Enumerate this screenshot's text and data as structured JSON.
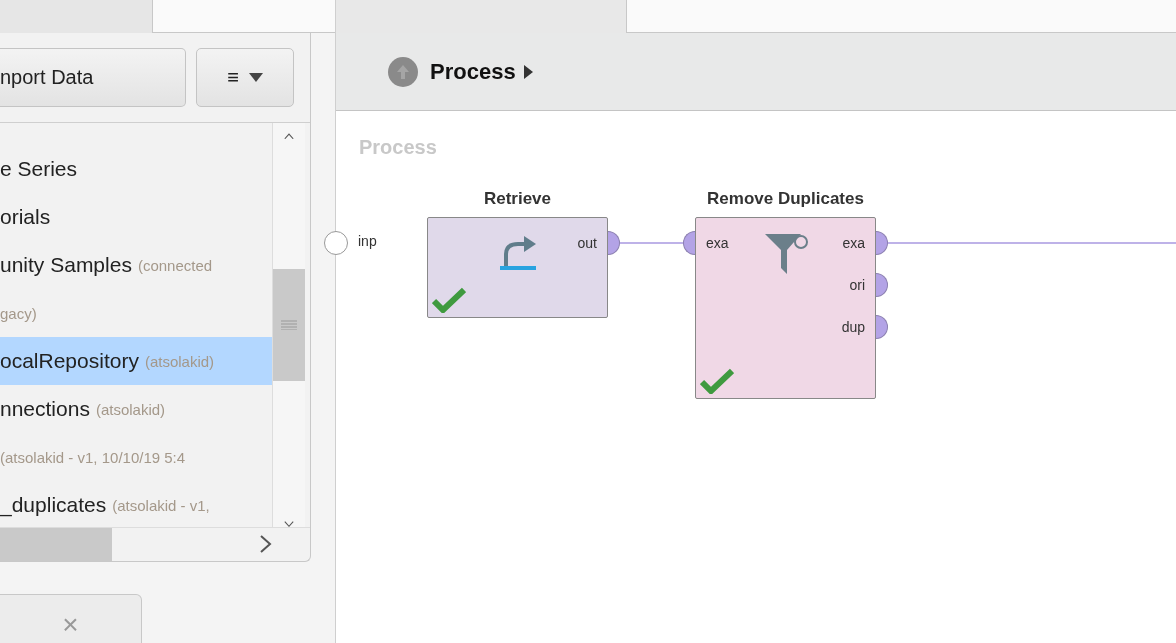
{
  "repository_panel": {
    "import_button": "nport Data",
    "menu_button": "≡",
    "rows": [
      {
        "name": "e Series",
        "detail": "",
        "selected": false
      },
      {
        "name": "orials",
        "detail": "",
        "selected": false
      },
      {
        "name": "unity Samples",
        "detail": "(connected",
        "selected": false
      },
      {
        "name": "",
        "detail": "gacy)",
        "selected": false
      },
      {
        "name": "ocalRepository",
        "detail": "(atsolakid)",
        "selected": true
      },
      {
        "name": "nnections",
        "detail": "(atsolakid)",
        "selected": false
      },
      {
        "name": "",
        "detail": "(atsolakid - v1, 10/10/19 5:4",
        "selected": false
      },
      {
        "name": "_duplicates",
        "detail": "(atsolakid - v1,",
        "selected": false
      }
    ],
    "bottom_tab_close": "×"
  },
  "process_panel": {
    "breadcrumb": "Process",
    "canvas_title": "Process",
    "input_port": "inp",
    "operators": [
      {
        "title": "Retrieve",
        "kind": "retrieve",
        "color": "#e0d9ea",
        "valid": true,
        "right_ports": [
          "out"
        ]
      },
      {
        "title": "Remove Duplicates",
        "kind": "filter",
        "color": "#f0d8e6",
        "valid": true,
        "left_ports": [
          "exa"
        ],
        "right_ports": [
          "exa",
          "ori",
          "dup"
        ]
      }
    ]
  }
}
